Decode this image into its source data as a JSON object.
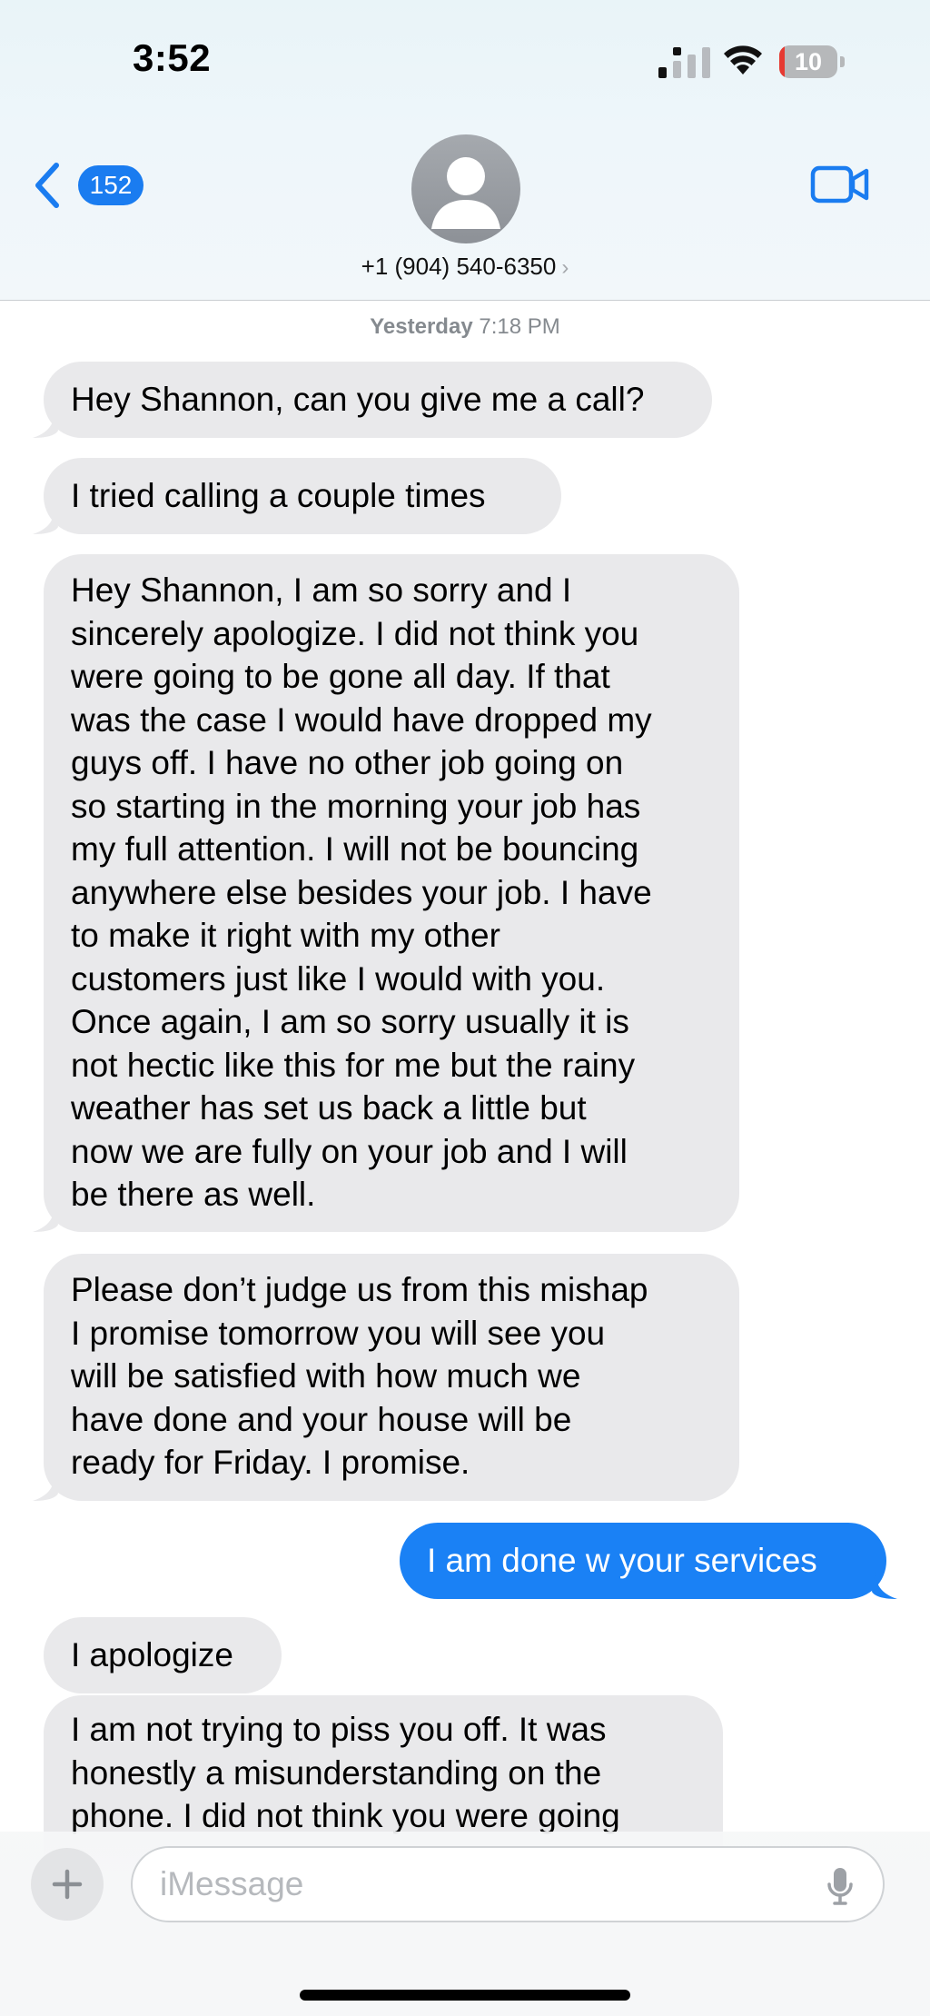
{
  "status_bar": {
    "time": "3:52",
    "battery_level": "10",
    "icons": [
      "cellular-signal-icon",
      "wifi-icon",
      "battery-icon"
    ]
  },
  "nav": {
    "back_count": "152",
    "contact_title": "+1 (904) 540-6350",
    "contact_chevron": "›",
    "icons": [
      "chevron-left-icon",
      "person-icon",
      "video-camera-icon"
    ],
    "accent_color": "#1a7cf0"
  },
  "conversation": {
    "timestamp_day": "Yesterday",
    "timestamp_time": "7:18 PM",
    "messages": [
      {
        "direction": "incoming",
        "text": "Hey Shannon, can you give me a call?"
      },
      {
        "direction": "incoming",
        "text": "I tried calling a couple times"
      },
      {
        "direction": "incoming",
        "text": "Hey Shannon, I am so sorry and I\nsincerely apologize. I did not think you\nwere going to be gone all day. If that\nwas the case I would have dropped my\nguys off. I have no other job going on\nso starting in the morning your job has\nmy full attention. I will not be bouncing\nanywhere else besides your job. I have\nto make it right with my other\ncustomers just like I would with you.\nOnce again, I am so sorry usually it is\nnot hectic like this for me but the rainy\nweather has set us back a little but\nnow we are fully on your job and I will\nbe there as well."
      },
      {
        "direction": "incoming",
        "text": "Please don’t judge us from this mishap\nI promise tomorrow you will see you\nwill be satisfied with how much we\nhave done and your house will be\nready for Friday. I promise."
      },
      {
        "direction": "outgoing",
        "text": "I am done w your services"
      },
      {
        "direction": "incoming",
        "text": "I apologize"
      },
      {
        "direction": "incoming",
        "text": "I am not trying to piss you off. It was\nhonestly a misunderstanding on the\nphone. I did not think you were going"
      }
    ],
    "colors": {
      "incoming_bubble": "#e9e9eb",
      "outgoing_bubble": "#1a81f5"
    }
  },
  "compose": {
    "placeholder": "iMessage",
    "value": "",
    "icons": [
      "plus-icon",
      "microphone-icon"
    ]
  }
}
